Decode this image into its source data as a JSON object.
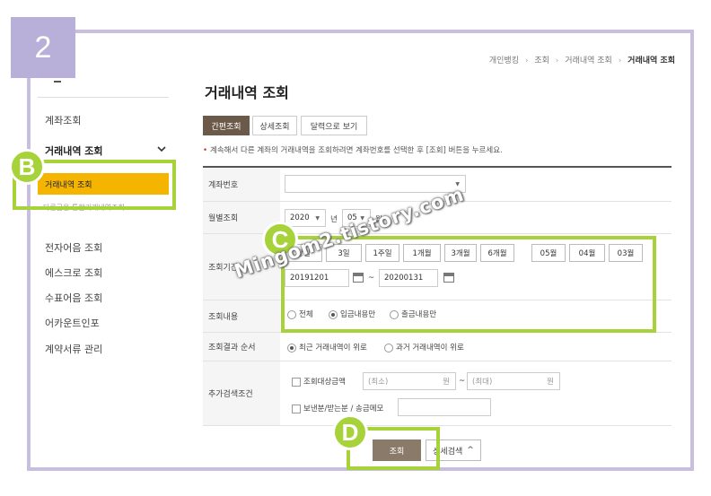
{
  "step_badge": "2",
  "breadcrumb": [
    "개인뱅킹",
    "조회",
    "거래내역 조회",
    "거래내역 조회"
  ],
  "breadcrumb_sep": "›",
  "sidebar": {
    "items": [
      "계좌조회",
      "전자어음 조회",
      "에스크로 조회",
      "수표어음 조회",
      "어카운트인포",
      "계약서류 관리"
    ],
    "group_label": "거래내역 조회",
    "group_chevron": "chevron-down-icon",
    "sub_active": "거래내역 조회",
    "sub_second": "다른금융 통합거래내역조회"
  },
  "annotations": {
    "b": "B",
    "c": "C",
    "d": "D"
  },
  "page_title": "거래내역 조회",
  "tabs": [
    {
      "label": "간편조회",
      "active": true
    },
    {
      "label": "상세조회",
      "active": false
    },
    {
      "label": "달력으로 보기",
      "active": false
    }
  ],
  "notice": "계속해서 다른 계좌의 거래내역을 조회하려면 계좌번호를 선택한 후 [조회] 버튼을 누르세요.",
  "form": {
    "account": {
      "label": "계좌번호",
      "value": "",
      "caret": "▼"
    },
    "monthly": {
      "label": "월별조회",
      "year": "2020",
      "year_unit": "년",
      "month": "05",
      "month_unit": "월"
    },
    "period": {
      "label": "조회기간",
      "quick_buttons": [
        "당일",
        "3일",
        "1주일",
        "1개월",
        "3개월",
        "6개월"
      ],
      "month_buttons": [
        "05월",
        "04월",
        "03월"
      ],
      "start_date": "20191201",
      "range_sep": "~",
      "end_date": "20200131"
    },
    "content": {
      "label": "조회내용",
      "options": [
        "전체",
        "입금내용만",
        "출금내용만"
      ],
      "selected": 1
    },
    "order": {
      "label": "조회결과 순서",
      "options": [
        "최근 거래내역이 위로",
        "과거 거래내역이 위로"
      ],
      "selected": 0
    },
    "extra": {
      "label": "추가검색조건",
      "amount_label": "조회대상금액",
      "min_placeholder": "(최소)",
      "max_placeholder": "(최대)",
      "won": "원",
      "range_sep": "~",
      "memo_label": "보낸분/받는분 / 송금메모"
    }
  },
  "buttons": {
    "submit": "조회",
    "detail": "상세검색",
    "detail_icon": "^"
  },
  "watermark": "Mingom2.tistory.com",
  "colors": {
    "accent": "#f4b400",
    "highlight": "#a8d23a",
    "badge": "#b9b0d9",
    "tab_active": "#6b5a4a"
  }
}
